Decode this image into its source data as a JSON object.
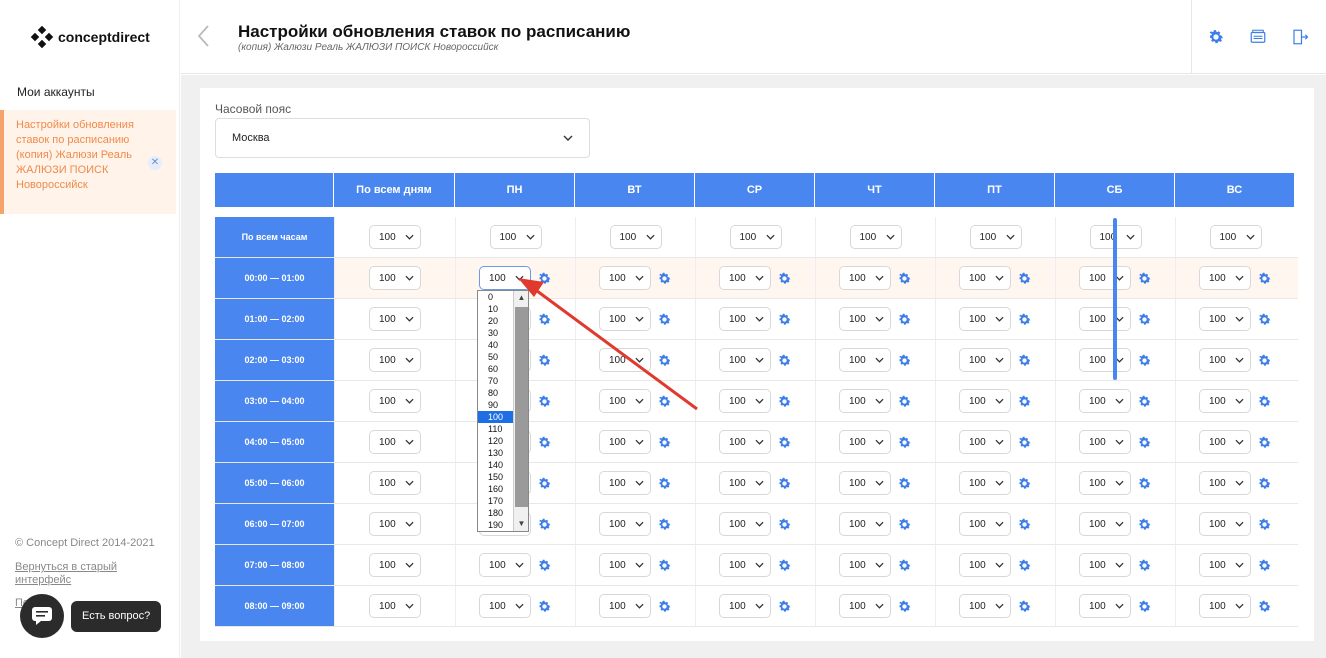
{
  "brand": "conceptdirect",
  "sidebar": {
    "accounts_label": "Мои аккаунты",
    "active_item": "Настройки обновления ставок по расписанию (копия) Жалюзи Реаль ЖАЛЮЗИ ПОИСК Новороссийск",
    "close_glyph": "✕",
    "copyright": "© Concept Direct 2014-2021",
    "old_ui_link": "Вернуться в старый интерфейс",
    "hidden_link": "Помощь"
  },
  "chat": {
    "tooltip": "Есть вопрос?"
  },
  "header": {
    "title": "Настройки обновления ставок по расписанию",
    "subtitle": "(копия) Жалюзи Реаль ЖАЛЮЗИ ПОИСК Новороссийск",
    "icons": [
      "gear-icon",
      "card-icon",
      "logout-icon"
    ]
  },
  "timezone": {
    "label": "Часовой пояс",
    "value": "Москва"
  },
  "grid": {
    "columns": [
      "По всем дням",
      "ПН",
      "ВТ",
      "СР",
      "ЧТ",
      "ПТ",
      "СБ",
      "ВС"
    ],
    "rows": [
      "По всем часам",
      "00:00 — 01:00",
      "01:00 — 02:00",
      "02:00 — 03:00",
      "03:00 — 04:00",
      "04:00 — 05:00",
      "05:00 — 06:00",
      "06:00 — 07:00",
      "07:00 — 08:00",
      "08:00 — 09:00"
    ],
    "cell_value": "100"
  },
  "dropdown": {
    "options": [
      "0",
      "10",
      "20",
      "30",
      "40",
      "50",
      "60",
      "70",
      "80",
      "90",
      "100",
      "110",
      "120",
      "130",
      "140",
      "150",
      "160",
      "170",
      "180",
      "190"
    ],
    "selected": "100"
  },
  "colors": {
    "accent": "#4a86f0",
    "highlight_row": "#fff6f0",
    "active_nav": "#f08a4b",
    "arrow": "#e03a2f"
  }
}
